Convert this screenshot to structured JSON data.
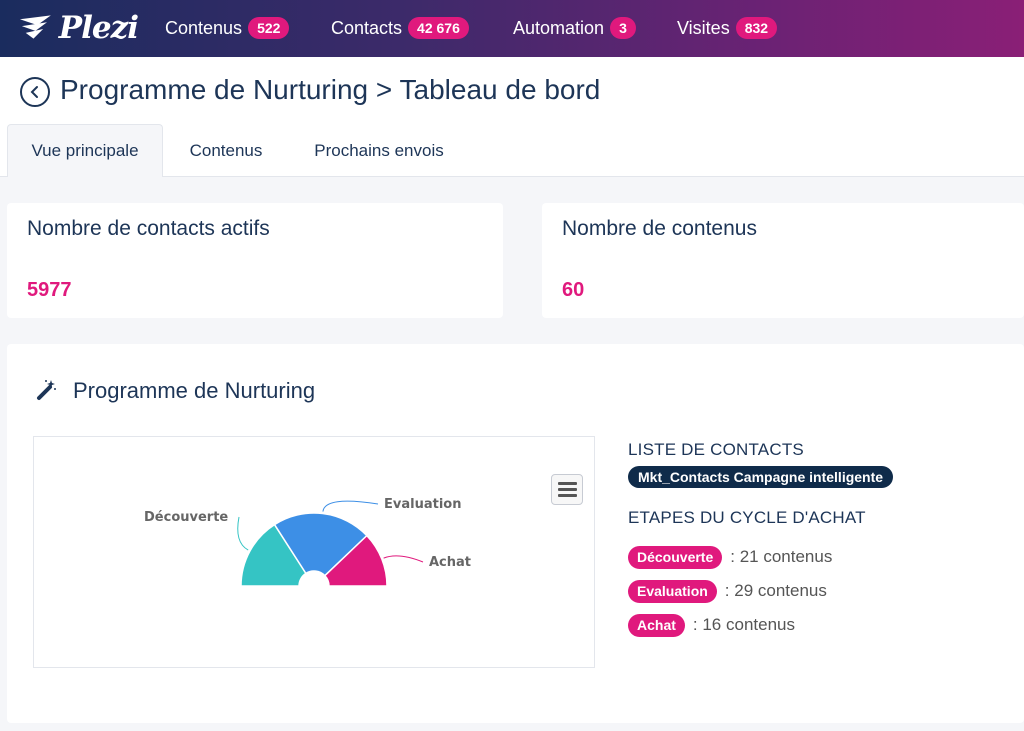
{
  "app": {
    "logo_text": "Plezi"
  },
  "nav": [
    {
      "label": "Contenus",
      "badge": "522"
    },
    {
      "label": "Contacts",
      "badge": "42 676"
    },
    {
      "label": "Automation",
      "badge": "3"
    },
    {
      "label": "Visites",
      "badge": "832"
    }
  ],
  "page": {
    "title": "Programme de Nurturing > Tableau de bord"
  },
  "tabs": [
    {
      "label": "Vue principale",
      "active": true
    },
    {
      "label": "Contenus",
      "active": false
    },
    {
      "label": "Prochains envois",
      "active": false
    }
  ],
  "stats": {
    "contacts": {
      "label": "Nombre de contacts actifs",
      "value": "5977"
    },
    "contents": {
      "label": "Nombre de contenus",
      "value": "60"
    }
  },
  "program": {
    "title": "Programme de Nurturing",
    "contact_list_heading": "LISTE DE CONTACTS",
    "contact_list_name": "Mkt_Contacts Campagne intelligente",
    "stages_heading": "ETAPES DU CYCLE D'ACHAT",
    "stages": [
      {
        "name": "Découverte",
        "count": ": 21 contenus"
      },
      {
        "name": "Evaluation",
        "count": ": 29 contenus"
      },
      {
        "name": "Achat",
        "count": ": 16 contenus"
      }
    ]
  },
  "colors": {
    "accent": "#e0197d",
    "navy": "#1d3557",
    "teal": "#35c4c4",
    "blue": "#3d8fe6"
  },
  "chart_data": {
    "type": "pie",
    "variant": "semi-donut",
    "categories": [
      "Découverte",
      "Evaluation",
      "Achat"
    ],
    "values": [
      21,
      29,
      16
    ],
    "colors": [
      "#35c4c4",
      "#3d8fe6",
      "#e0197d"
    ]
  }
}
